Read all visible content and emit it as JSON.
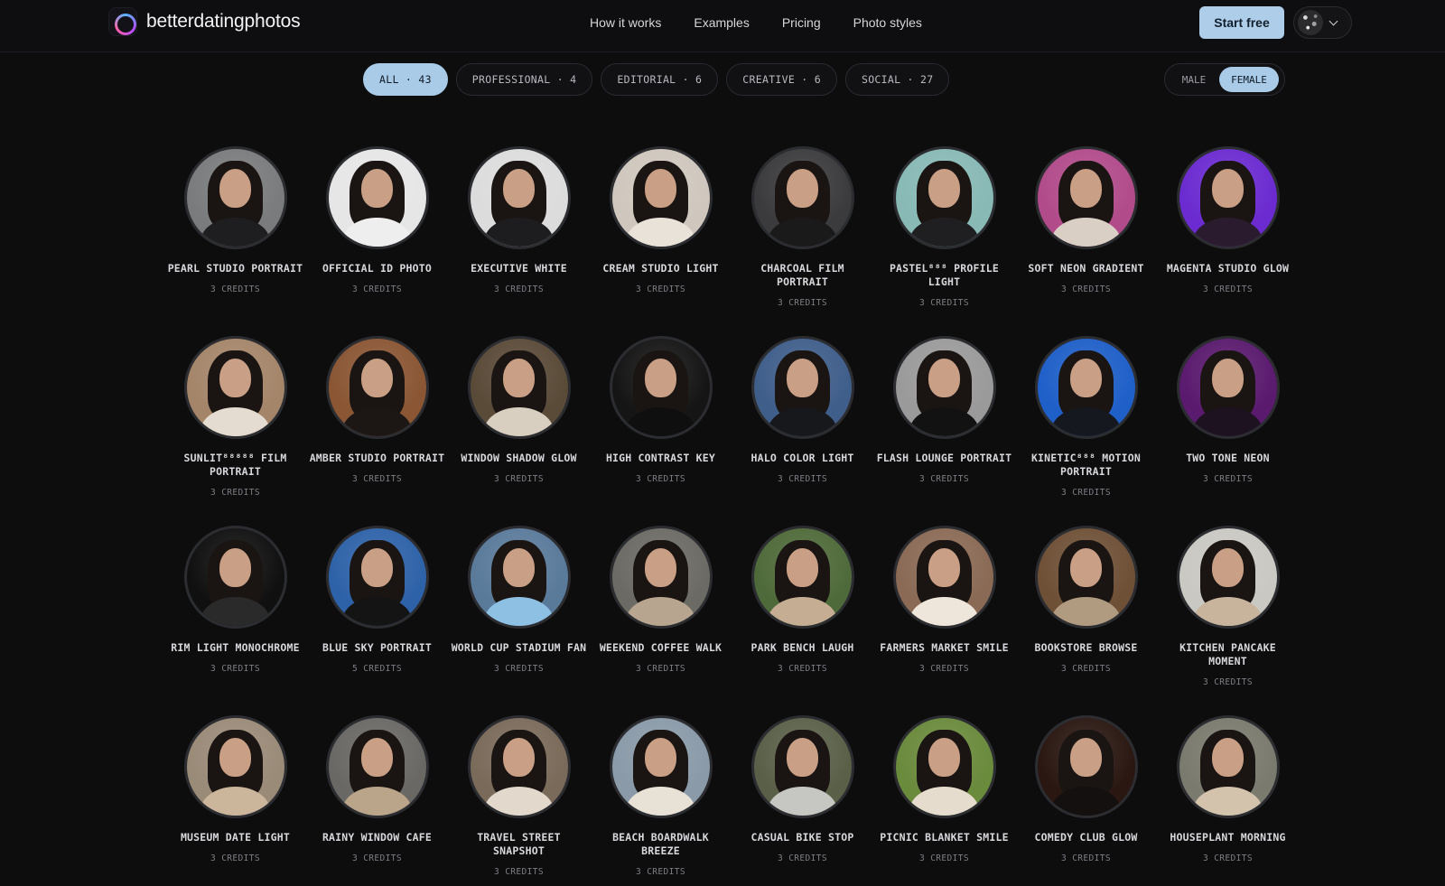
{
  "brand": {
    "name": "betterdatingphotos"
  },
  "nav": {
    "items": [
      "How it works",
      "Examples",
      "Pricing",
      "Photo styles"
    ]
  },
  "header": {
    "cta": "Start free"
  },
  "filters": [
    "ALL · 43",
    "PROFESSIONAL · 4",
    "EDITORIAL · 6",
    "CREATIVE · 6",
    "SOCIAL · 27"
  ],
  "active_filter": "ALL · 43",
  "gender": {
    "male": "MALE",
    "female": "FEMALE",
    "selected": "FEMALE"
  },
  "colors": {
    "accent": "#a9cbe8",
    "background": "#0d0d0e"
  },
  "styles": [
    {
      "name": "PEARL STUDIO PORTRAIT",
      "credits": "3 CREDITS",
      "bg": "#7a7b7d",
      "top": "#1e1e20"
    },
    {
      "name": "OFFICIAL ID PHOTO",
      "credits": "3 CREDITS",
      "bg": "#e6e6e6",
      "top": "#eeeeee"
    },
    {
      "name": "EXECUTIVE WHITE",
      "credits": "3 CREDITS",
      "bg": "#dcdcdc",
      "top": "#1d1d20"
    },
    {
      "name": "CREAM STUDIO LIGHT",
      "credits": "3 CREDITS",
      "bg": "#cfc7bd",
      "top": "#e9e2d8"
    },
    {
      "name": "CHARCOAL FILM PORTRAIT",
      "credits": "3 CREDITS",
      "bg": "#3b3b3d",
      "top": "#1a1a1b"
    },
    {
      "name": "PASTEL⁸⁸⁸ PROFILE LIGHT",
      "credits": "3 CREDITS",
      "bg": "#88b9b5",
      "top": "#1f1f22"
    },
    {
      "name": "SOFT NEON GRADIENT",
      "credits": "3 CREDITS",
      "bg": "#b14b8a",
      "top": "#d9cfc4"
    },
    {
      "name": "MAGENTA STUDIO GLOW",
      "credits": "3 CREDITS",
      "bg": "#6b2bd0",
      "top": "#2b1b2f"
    },
    {
      "name": "SUNLIT⁸⁸⁸⁸⁸ FILM PORTRAIT",
      "credits": "3 CREDITS",
      "bg": "#a4856a",
      "top": "#e4dcd0"
    },
    {
      "name": "AMBER STUDIO PORTRAIT",
      "credits": "3 CREDITS",
      "bg": "#8a5634",
      "top": "#1c1714"
    },
    {
      "name": "WINDOW SHADOW GLOW",
      "credits": "3 CREDITS",
      "bg": "#5a4a38",
      "top": "#d8cfc1"
    },
    {
      "name": "HIGH CONTRAST KEY",
      "credits": "3 CREDITS",
      "bg": "#151515",
      "top": "#0f0f0f"
    },
    {
      "name": "HALO COLOR LIGHT",
      "credits": "3 CREDITS",
      "bg": "#3f5e8a",
      "top": "#17181c"
    },
    {
      "name": "FLASH LOUNGE PORTRAIT",
      "credits": "3 CREDITS",
      "bg": "#9a9a9a",
      "top": "#121212"
    },
    {
      "name": "KINETIC⁸⁸⁸ MOTION PORTRAIT",
      "credits": "3 CREDITS",
      "bg": "#1f5fc8",
      "top": "#16181f"
    },
    {
      "name": "TWO TONE NEON",
      "credits": "3 CREDITS",
      "bg": "#5a1a6e",
      "top": "#1c1220"
    },
    {
      "name": "RIM LIGHT MONOCHROME",
      "credits": "3 CREDITS",
      "bg": "#101010",
      "top": "#2a2a2a"
    },
    {
      "name": "BLUE SKY PORTRAIT",
      "credits": "5 CREDITS",
      "bg": "#2e62a8",
      "top": "#141414"
    },
    {
      "name": "WORLD CUP STADIUM FAN",
      "credits": "3 CREDITS",
      "bg": "#5a7a9a",
      "top": "#8ec0e4"
    },
    {
      "name": "WEEKEND COFFEE WALK",
      "credits": "3 CREDITS",
      "bg": "#6c6a64",
      "top": "#b7a58f"
    },
    {
      "name": "PARK BENCH LAUGH",
      "credits": "3 CREDITS",
      "bg": "#4f6a3a",
      "top": "#c4ad93"
    },
    {
      "name": "FARMERS MARKET SMILE",
      "credits": "3 CREDITS",
      "bg": "#8a6a55",
      "top": "#eee6da"
    },
    {
      "name": "BOOKSTORE BROWSE",
      "credits": "3 CREDITS",
      "bg": "#6e5036",
      "top": "#b09a80"
    },
    {
      "name": "KITCHEN PANCAKE MOMENT",
      "credits": "3 CREDITS",
      "bg": "#c9c8c2",
      "top": "#c8b49c"
    },
    {
      "name": "MUSEUM DATE LIGHT",
      "credits": "3 CREDITS",
      "bg": "#9a8a78",
      "top": "#cbb69c"
    },
    {
      "name": "RAINY WINDOW CAFE",
      "credits": "3 CREDITS",
      "bg": "#6a6864",
      "top": "#bba58a"
    },
    {
      "name": "TRAVEL STREET SNAPSHOT",
      "credits": "3 CREDITS",
      "bg": "#7a6a5a",
      "top": "#e2d9cc"
    },
    {
      "name": "BEACH BOARDWALK BREEZE",
      "credits": "3 CREDITS",
      "bg": "#8a9aa8",
      "top": "#e8e2d6"
    },
    {
      "name": "CASUAL BIKE STOP",
      "credits": "3 CREDITS",
      "bg": "#5a6048",
      "top": "#c6c6c2"
    },
    {
      "name": "PICNIC BLANKET SMILE",
      "credits": "3 CREDITS",
      "bg": "#6a8a3c",
      "top": "#e6dccd"
    },
    {
      "name": "COMEDY CLUB GLOW",
      "credits": "3 CREDITS",
      "bg": "#2a1712",
      "top": "#151010"
    },
    {
      "name": "HOUSEPLANT MORNING",
      "credits": "3 CREDITS",
      "bg": "#7a7a6e",
      "top": "#d3c3ad"
    }
  ]
}
